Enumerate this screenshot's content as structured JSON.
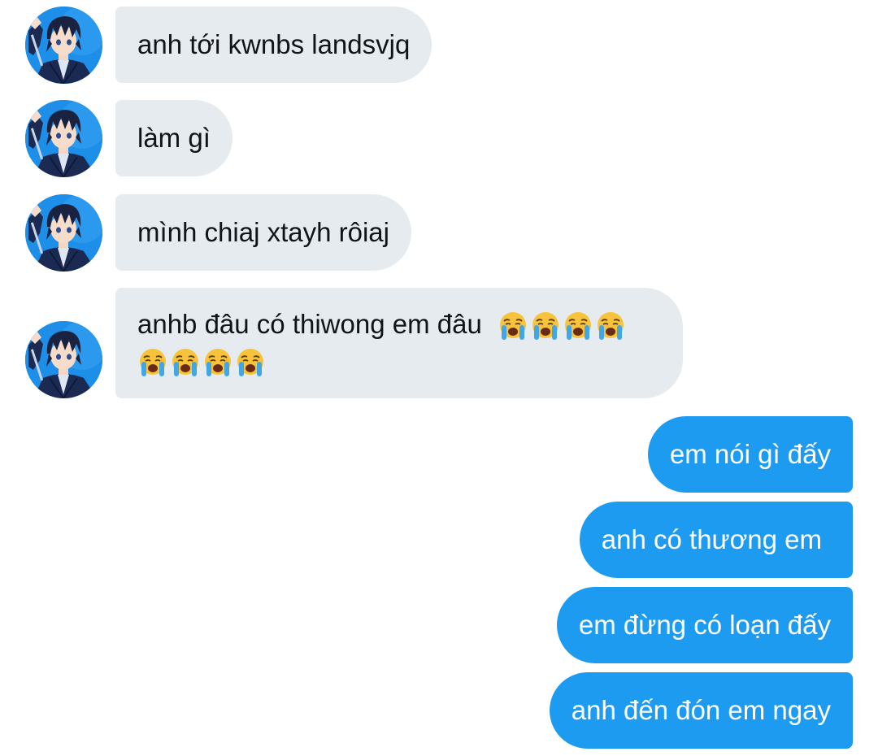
{
  "conversation": {
    "incoming": [
      {
        "text": "anh tới kwnbs landsvjq"
      },
      {
        "text": "làm gì"
      },
      {
        "text": "mình chiaj xtayh rôiaj"
      },
      {
        "text": "anhb đâu có thiwong em đâu",
        "emoji": "loudly-crying-face",
        "emoji_count_line1": 4,
        "emoji_count_line2": 4
      }
    ],
    "outgoing": [
      {
        "text": "em nói gì đấy"
      },
      {
        "text": "anh có thương em"
      },
      {
        "text": "em đừng có loạn đấy"
      },
      {
        "text": "anh đến đón em ngay"
      }
    ]
  },
  "colors": {
    "incoming_bubble": "#e6ebef",
    "outgoing_bubble": "#1d9bf0",
    "avatar_background": "#1d8fe8"
  },
  "avatar_icon": "anime-boy-avatar"
}
